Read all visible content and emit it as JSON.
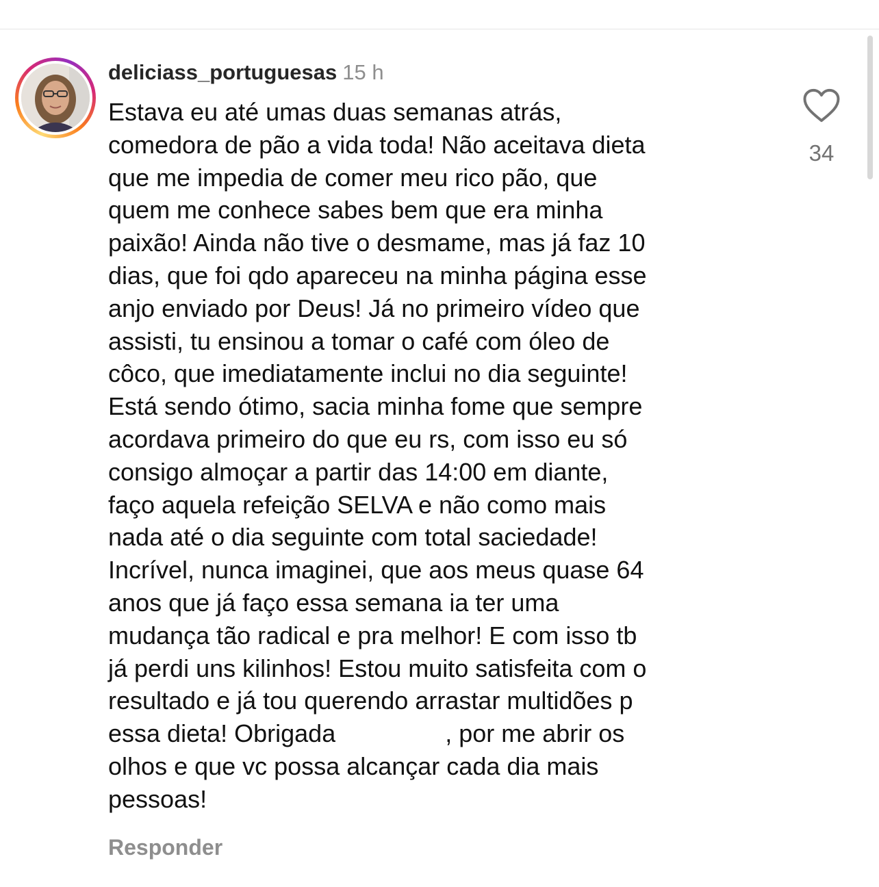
{
  "comment": {
    "username": "deliciass_portuguesas",
    "time": "15 h",
    "text_lines": [
      "Estava eu até umas duas semanas atrás,",
      "comedora de pão a vida toda! Não aceitava dieta",
      "que me impedia de comer meu rico pão, que",
      "quem me conhece sabes bem que era minha",
      "paixão! Ainda não tive o desmame, mas já faz 10",
      "dias, que foi qdo apareceu na minha página esse",
      "anjo enviado por Deus! Já no primeiro vídeo que",
      "assisti, tu ensinou a tomar o café com óleo de",
      "côco, que imediatamente inclui no dia seguinte!",
      "Está sendo ótimo, sacia minha fome que sempre",
      "acordava primeiro do que eu rs, com isso eu só",
      "consigo almoçar a partir das 14:00 em diante,",
      "faço aquela refeição SELVA e não como mais",
      "nada até o dia seguinte com total saciedade!",
      "Incrível, nunca imaginei, que aos meus quase 64",
      "anos que já faço essa semana ia ter uma",
      "mudança tão radical e pra melhor! E com isso tb",
      "já perdi uns kilinhos! Estou muito satisfeita com o",
      "resultado e já tou querendo arrastar multidões p",
      "essa dieta! Obrigada",
      ", por me abrir os",
      "olhos e que vc possa alcançar cada dia mais",
      "pessoas!"
    ],
    "like_count": "34",
    "reply_label": "Responder"
  },
  "icons": {
    "like": "heart-outline-icon",
    "avatar": "profile-photo"
  },
  "colors": {
    "username": "#262626",
    "meta_gray": "#8e8e8e",
    "like_count": "#737373",
    "ring": [
      "#feda75",
      "#fa7e1e",
      "#d62976",
      "#962fbf"
    ]
  }
}
